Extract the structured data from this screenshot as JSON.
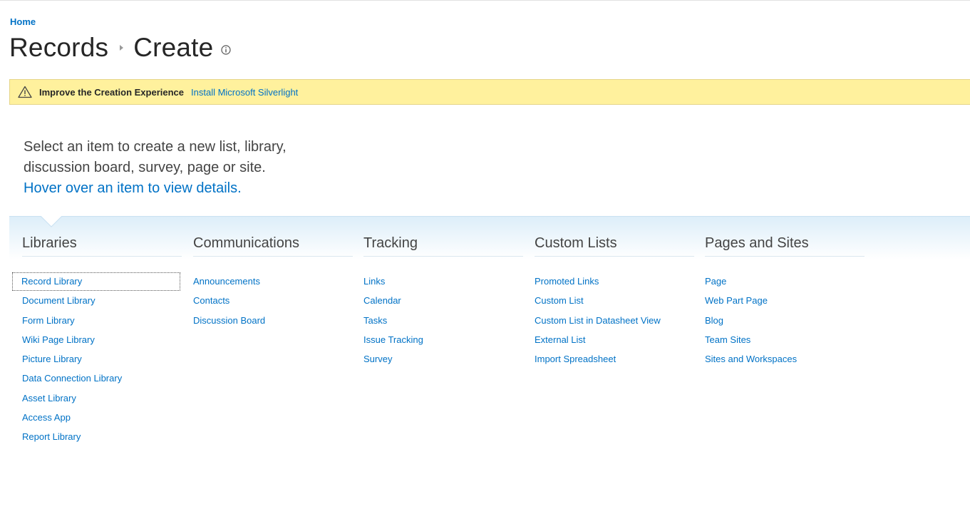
{
  "breadcrumb": {
    "home": "Home"
  },
  "title": {
    "part1": "Records",
    "part2": "Create"
  },
  "notification": {
    "bold": "Improve the Creation Experience",
    "link": "Install Microsoft Silverlight"
  },
  "intro": {
    "line1": "Select an item to create a new list, library,",
    "line2": "discussion board, survey, page or site.",
    "line3": "Hover over an item to view details."
  },
  "columns": [
    {
      "heading": "Libraries",
      "items": [
        "Record Library",
        "Document Library",
        "Form Library",
        "Wiki Page Library",
        "Picture Library",
        "Data Connection Library",
        "Asset Library",
        "Access App",
        "Report Library"
      ]
    },
    {
      "heading": "Communications",
      "items": [
        "Announcements",
        "Contacts",
        "Discussion Board"
      ]
    },
    {
      "heading": "Tracking",
      "items": [
        "Links",
        "Calendar",
        "Tasks",
        "Issue Tracking",
        "Survey"
      ]
    },
    {
      "heading": "Custom Lists",
      "items": [
        "Promoted Links",
        "Custom List",
        "Custom List in Datasheet View",
        "External List",
        "Import Spreadsheet"
      ]
    },
    {
      "heading": "Pages and Sites",
      "items": [
        "Page",
        "Web Part Page",
        "Blog",
        "Team Sites",
        "Sites and Workspaces"
      ]
    }
  ],
  "colors": {
    "link": "#0072c6",
    "notify_bg": "#fff19d",
    "text": "#444444"
  },
  "icons": {
    "info": "info-icon",
    "warning": "warning-icon"
  }
}
